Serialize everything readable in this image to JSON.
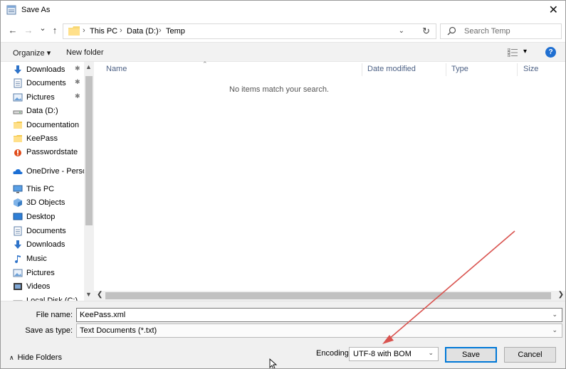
{
  "window": {
    "title": "Save As",
    "close_glyph": "✕"
  },
  "nav": {
    "back_glyph": "←",
    "forward_glyph": "→",
    "recent_glyph": "⌄",
    "up_glyph": "↑"
  },
  "address": {
    "crumbs": [
      "This PC",
      "Data (D:)",
      "Temp"
    ],
    "sep": "›",
    "dropdown_glyph": "⌄",
    "refresh_glyph": "↻"
  },
  "search": {
    "placeholder": "Search Temp"
  },
  "commands": {
    "organize": "Organize ▾",
    "new_folder": "New folder",
    "view_dd": "▾",
    "help": "?"
  },
  "sidebar": {
    "items": [
      {
        "label": "Downloads",
        "icon": "download-arrow-icon",
        "pinned": true
      },
      {
        "label": "Documents",
        "icon": "document-icon",
        "pinned": true
      },
      {
        "label": "Pictures",
        "icon": "pictures-icon",
        "pinned": true
      },
      {
        "label": "Data (D:)",
        "icon": "drive-icon",
        "pinned": false
      },
      {
        "label": "Documentation",
        "icon": "folder-icon",
        "pinned": false
      },
      {
        "label": "KeePass",
        "icon": "folder-icon",
        "pinned": false
      },
      {
        "label": "Passwordstate",
        "icon": "passwordstate-icon",
        "pinned": false
      },
      {
        "label": "OneDrive - Persor",
        "icon": "onedrive-icon",
        "pinned": false
      },
      {
        "label": "This PC",
        "icon": "computer-icon",
        "pinned": false
      },
      {
        "label": "3D Objects",
        "icon": "3d-objects-icon",
        "pinned": false
      },
      {
        "label": "Desktop",
        "icon": "desktop-icon",
        "pinned": false
      },
      {
        "label": "Documents",
        "icon": "document-icon",
        "pinned": false
      },
      {
        "label": "Downloads",
        "icon": "download-arrow-icon",
        "pinned": false
      },
      {
        "label": "Music",
        "icon": "music-icon",
        "pinned": false
      },
      {
        "label": "Pictures",
        "icon": "pictures-icon",
        "pinned": false
      },
      {
        "label": "Videos",
        "icon": "videos-icon",
        "pinned": false
      },
      {
        "label": "Local Disk (C:)",
        "icon": "drive-icon",
        "pinned": false
      }
    ],
    "pin_glyph": "📌"
  },
  "columns": {
    "name": "Name",
    "date_modified": "Date modified",
    "type": "Type",
    "size": "Size"
  },
  "content": {
    "empty_message": "No items match your search."
  },
  "form": {
    "file_name_label": "File name:",
    "file_name_value": "KeePass.xml",
    "save_as_type_label": "Save as type:",
    "save_as_type_value": "Text Documents (*.txt)",
    "hide_folders": "Hide Folders",
    "encoding_label": "Encoding:",
    "encoding_value": "UTF-8 with BOM",
    "save": "Save",
    "cancel": "Cancel"
  },
  "colors": {
    "accent": "#0078d7",
    "annotation_arrow": "#d9534f"
  }
}
